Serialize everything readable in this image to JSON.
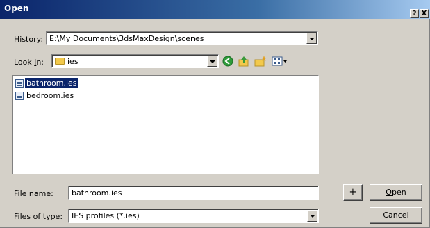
{
  "window": {
    "title": "Open"
  },
  "titlebar": {
    "help_label": "?",
    "close_label": "X"
  },
  "history": {
    "label": "History:",
    "value": "E:\\My Documents\\3dsMaxDesign\\scenes"
  },
  "lookin": {
    "label_pre": "Look ",
    "label_u": "i",
    "label_post": "n:",
    "value": "ies"
  },
  "toolbar": {
    "icons": [
      "back-icon",
      "up-folder-icon",
      "new-folder-icon",
      "view-menu-icon"
    ]
  },
  "files": [
    {
      "name": "bathroom.ies",
      "selected": true
    },
    {
      "name": "bedroom.ies",
      "selected": false
    }
  ],
  "filename": {
    "label_pre": "File ",
    "label_u": "n",
    "label_post": "ame:",
    "value": "bathroom.ies"
  },
  "filetype": {
    "label_pre": "Files of ",
    "label_u": "t",
    "label_post": "ype:",
    "value": "IES profiles (*.ies)"
  },
  "buttons": {
    "plus": "+",
    "open_u": "O",
    "open_rest": "pen",
    "cancel": "Cancel"
  },
  "colors": {
    "title_start": "#0a246a",
    "title_end": "#a6caf0",
    "selection": "#0a246a",
    "face": "#d4d0c8"
  }
}
